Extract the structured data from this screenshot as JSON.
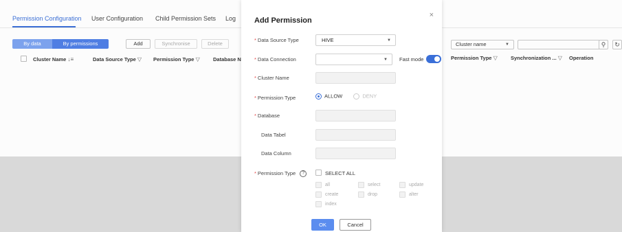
{
  "tabs": [
    {
      "label": "Permission Configuration",
      "active": true
    },
    {
      "label": "User Configuration"
    },
    {
      "label": "Child Permission Sets"
    },
    {
      "label": "Log"
    }
  ],
  "toolbar": {
    "by_data": "By data",
    "by_permissions": "By permissions",
    "add": "Add",
    "synchronise": "Synchronise",
    "delete": "Delete"
  },
  "table_left_headers": [
    "Cluster Name",
    "Data Source Type",
    "Permission Type",
    "Database Na"
  ],
  "right_filter": {
    "cluster_select": "Cluster name"
  },
  "table_right_headers": [
    "Permission Type",
    "Synchronization ...",
    "Operation"
  ],
  "modal": {
    "title": "Add Permission",
    "close": "×",
    "fields": {
      "data_source_type_label": "Data Source Type",
      "data_source_type_value": "HIVE",
      "data_connection_label": "Data Connection",
      "fast_mode_label": "Fast mode",
      "cluster_name_label": "Cluster Name",
      "permission_type_label": "Permission Type",
      "allow_label": "ALLOW",
      "deny_label": "DENY",
      "database_label": "Database",
      "data_tabel_label": "Data Tabel",
      "data_column_label": "Data Column",
      "permission_type2_label": "Permission Type",
      "select_all_label": "SELECT ALL"
    },
    "permissions": [
      {
        "label": "all"
      },
      {
        "label": "select"
      },
      {
        "label": "update"
      },
      {
        "label": "create"
      },
      {
        "label": "drop"
      },
      {
        "label": "alter"
      },
      {
        "label": "index"
      }
    ],
    "ok": "OK",
    "cancel": "Cancel"
  },
  "colors": {
    "accent": "#3a6fd8",
    "button_primary": "#5b8def",
    "required": "#e54545"
  },
  "icons": {
    "sort": "sort-icon",
    "filter": "funnel-icon",
    "search": "search-icon",
    "refresh": "refresh-icon",
    "help": "help-circle-icon"
  }
}
